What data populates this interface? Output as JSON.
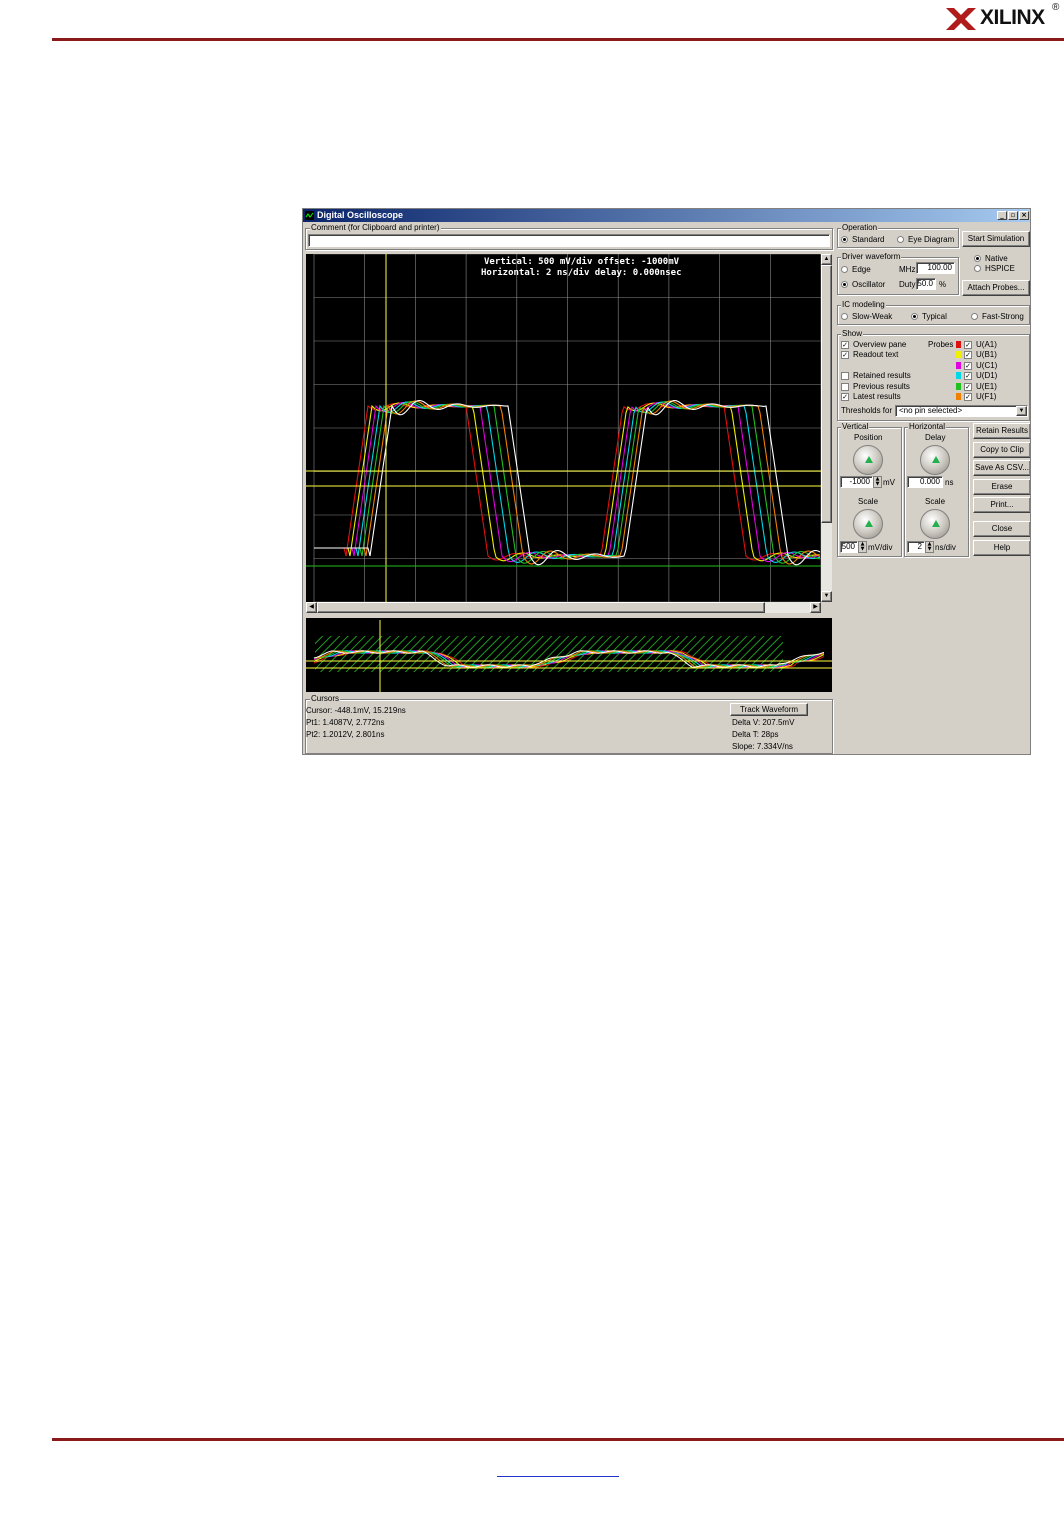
{
  "page": {
    "logo_text": "XILINX",
    "logo_mark": "®"
  },
  "window": {
    "title": "Digital Oscilloscope",
    "comment_label": "Comment (for Clipboard and printer)",
    "comment_value": "",
    "scope": {
      "line1": "Vertical: 500 mV/div  offset: -1000mV",
      "line2": "Horizontal: 2 ns/div  delay: 0.000nsec"
    },
    "operation": {
      "label": "Operation",
      "standard": "Standard",
      "eye_diagram": "Eye Diagram",
      "start_button": "Start Simulation"
    },
    "driver": {
      "label": "Driver waveform",
      "edge": "Edge",
      "oscillator": "Oscillator",
      "mhz_label": "MHz",
      "mhz_value": "100.00",
      "duty_label": "Duty",
      "duty_value": "50.0",
      "duty_unit": "%",
      "native": "Native",
      "hspice": "HSPICE",
      "attach_button": "Attach Probes..."
    },
    "ic_modeling": {
      "label": "IC modeling",
      "slow_weak": "Slow-Weak",
      "typical": "Typical",
      "fast_strong": "Fast-Strong"
    },
    "show": {
      "label": "Show",
      "overview": "Overview pane",
      "readout": "Readout text",
      "retained": "Retained results",
      "previous": "Previous results",
      "latest": "Latest results",
      "probes_label": "Probes",
      "probes": [
        {
          "name": "U(A1)",
          "color": "#e01010"
        },
        {
          "name": "U(B1)",
          "color": "#f0f000"
        },
        {
          "name": "U(C1)",
          "color": "#e000e0"
        },
        {
          "name": "U(D1)",
          "color": "#00d8e8"
        },
        {
          "name": "U(E1)",
          "color": "#20c020"
        },
        {
          "name": "U(F1)",
          "color": "#f08000"
        }
      ],
      "thresholds_label": "Thresholds for",
      "thresholds_value": "<no pin selected>"
    },
    "vertical": {
      "label": "Vertical",
      "position_label": "Position",
      "position_value": "-1000",
      "position_unit": "mV",
      "scale_label": "Scale",
      "scale_value": "500",
      "scale_unit": "mV/div"
    },
    "horizontal": {
      "label": "Horizontal",
      "delay_label": "Delay",
      "delay_value": "0.000",
      "delay_unit": "ns",
      "scale_label": "Scale",
      "scale_value": "2",
      "scale_unit": "ns/div"
    },
    "buttons": {
      "retain": "Retain Results",
      "copy": "Copy to Clip",
      "save": "Save As CSV...",
      "erase": "Erase",
      "print": "Print...",
      "close": "Close",
      "help": "Help"
    },
    "cursors": {
      "label": "Cursors",
      "cursor": "Cursor: -448.1mV, 15.219ns",
      "pt1": "Pt1: 1.4087V, 2.772ns",
      "pt2": "Pt2: 1.2012V, 2.801ns",
      "track_button": "Track Waveform",
      "delta_v": "Delta V: 207.5mV",
      "delta_t": "Delta T: 28ps",
      "slope": "Slope: 7.334V/ns"
    }
  }
}
